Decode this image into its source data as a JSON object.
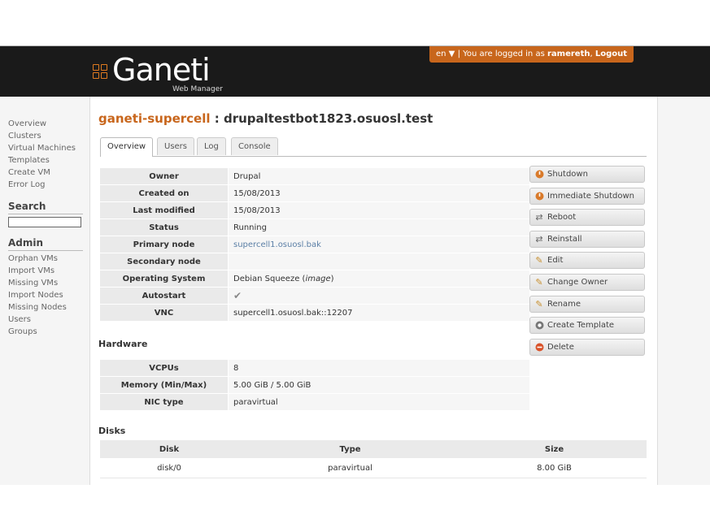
{
  "header": {
    "logo_text": "Ganeti",
    "logo_sub": "Web Manager",
    "lang": "en",
    "logged_prefix": "| You are logged in as",
    "username": "ramereth",
    "logout": "Logout"
  },
  "sidebar": {
    "main_links": [
      "Overview",
      "Clusters",
      "Virtual Machines",
      "Templates",
      "Create VM",
      "Error Log"
    ],
    "search_heading": "Search",
    "admin_heading": "Admin",
    "admin_links": [
      "Orphan VMs",
      "Import VMs",
      "Missing VMs",
      "Import Nodes",
      "Missing Nodes",
      "Users",
      "Groups"
    ]
  },
  "title": {
    "cluster": "ganeti-supercell",
    "separator": " : ",
    "vm": "drupaltestbot1823.osuosl.test"
  },
  "tabs": [
    "Overview",
    "Users",
    "Log",
    "Console"
  ],
  "info": {
    "owner_label": "Owner",
    "owner": "Drupal",
    "created_label": "Created on",
    "created": "15/08/2013",
    "modified_label": "Last modified",
    "modified": "15/08/2013",
    "status_label": "Status",
    "status": "Running",
    "primary_label": "Primary node",
    "primary": "supercell1.osuosl.bak",
    "secondary_label": "Secondary node",
    "secondary": "",
    "os_label": "Operating System",
    "os": "Debian Squeeze",
    "os_image": "image",
    "autostart_label": "Autostart",
    "vnc_label": "VNC",
    "vnc": "supercell1.osuosl.bak::12207"
  },
  "hardware": {
    "heading": "Hardware",
    "vcpus_label": "VCPUs",
    "vcpus": "8",
    "memory_label": "Memory (Min/Max)",
    "memory": "5.00 GiB / 5.00 GiB",
    "nic_label": "NIC type",
    "nic": "paravirtual"
  },
  "actions": {
    "shutdown": "Shutdown",
    "immediate_shutdown": "Immediate Shutdown",
    "reboot": "Reboot",
    "reinstall": "Reinstall",
    "edit": "Edit",
    "change_owner": "Change Owner",
    "rename": "Rename",
    "create_template": "Create Template",
    "delete": "Delete"
  },
  "disks": {
    "heading": "Disks",
    "col_disk": "Disk",
    "col_type": "Type",
    "col_size": "Size",
    "rows": [
      {
        "disk": "disk/0",
        "type": "paravirtual",
        "size": "8.00 GiB"
      }
    ]
  },
  "colors": {
    "accent": "#c8661c",
    "header_bg": "#1a1a1a",
    "link": "#5b7fa6"
  }
}
